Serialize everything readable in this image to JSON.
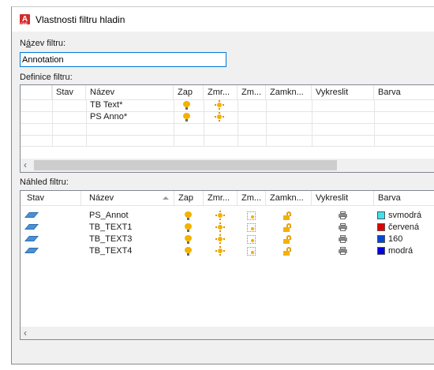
{
  "window": {
    "title": "Vlastnosti filtru hladin"
  },
  "filter_name": {
    "label_pre": "N",
    "label_underlined": "á",
    "label_post": "zev filtru:",
    "value": "Annotation"
  },
  "definition": {
    "label": "Definice filtru:",
    "columns": [
      "Stav",
      "Název",
      "Zap",
      "Zmr...",
      "Zm...",
      "Zamkn...",
      "Vykreslit",
      "Barva"
    ],
    "rows": [
      {
        "name": "TB  Text*",
        "on": "bulb-icon",
        "freeze": "sun-icon"
      },
      {
        "name": "PS  Anno*",
        "on": "bulb-icon",
        "freeze": "sun-icon"
      }
    ]
  },
  "preview": {
    "label": "Náhled filtru:",
    "columns": [
      "Stav",
      "Název",
      "Zap",
      "Zmr...",
      "Zm...",
      "Zamkn...",
      "Vykreslit",
      "Barva"
    ],
    "rows": [
      {
        "name": "PS_Annot",
        "color_name": "svmodrá",
        "color_hex": "#40e0f0"
      },
      {
        "name": "TB_TEXT1",
        "color_name": "červená",
        "color_hex": "#e00000"
      },
      {
        "name": "TB_TEXT3",
        "color_name": "160",
        "color_hex": "#0048d8"
      },
      {
        "name": "TB_TEXT4",
        "color_name": "modrá",
        "color_hex": "#0000e0"
      }
    ]
  }
}
